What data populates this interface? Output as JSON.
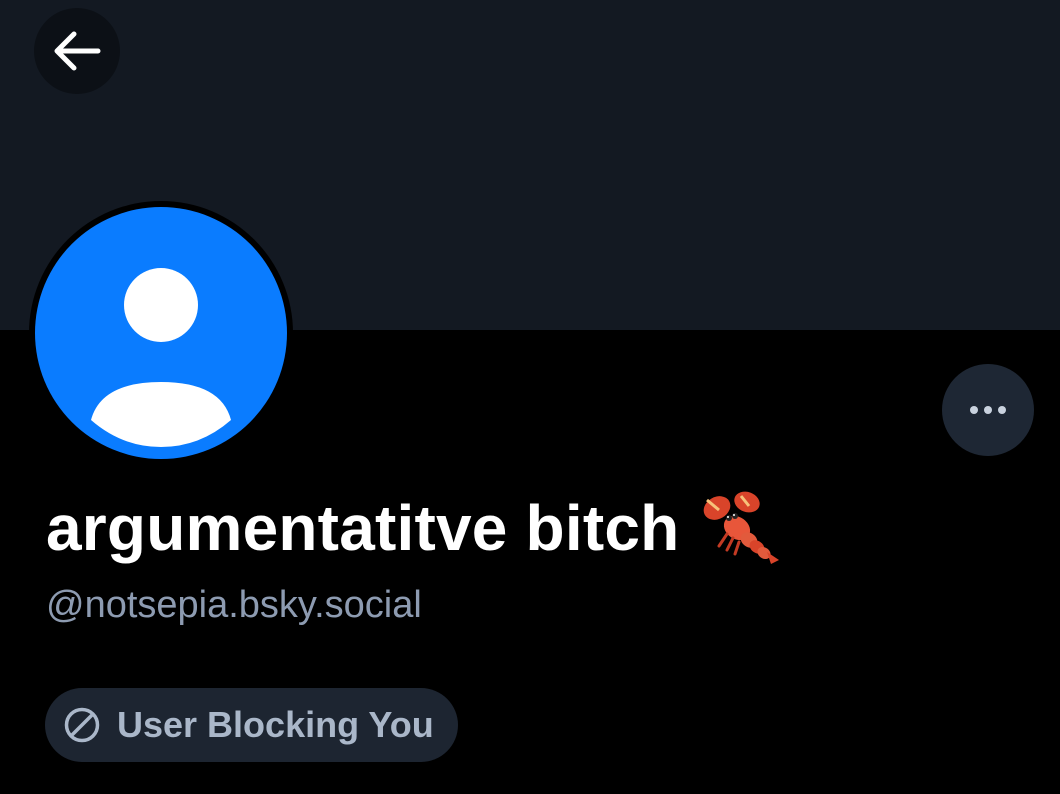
{
  "profile": {
    "display_name": "argumentatitve bitch",
    "display_name_emoji": "lobster-icon",
    "handle": "@notsepia.bsky.social",
    "blocking_status": "User Blocking You"
  },
  "icons": {
    "back": "arrow-left-icon",
    "more": "ellipsis-icon",
    "avatar": "default-user-icon",
    "blocking": "block-icon"
  },
  "colors": {
    "banner": "#131922",
    "background": "#000000",
    "avatar": "#0a7cff",
    "handle": "#8d9bb1",
    "badge": "#1d2531",
    "badge_text": "#aab7c9"
  }
}
